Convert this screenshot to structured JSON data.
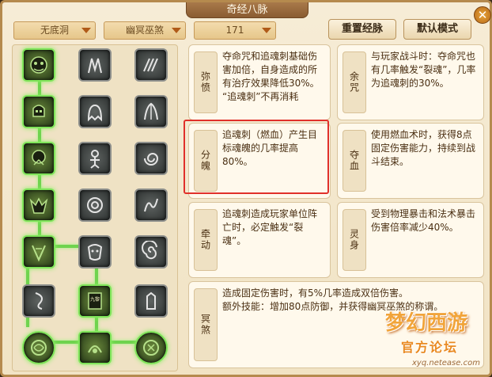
{
  "window": {
    "title": "奇经八脉",
    "close_label": "✕"
  },
  "toolbar": {
    "dropdown_1": "无底洞",
    "dropdown_2": "幽冥巫煞",
    "dropdown_3": "171",
    "reset_label": "重置经脉",
    "default_label": "默认模式"
  },
  "skill_tree": {
    "rows": [
      {
        "row": 1,
        "states": [
          "active",
          "inactive",
          "inactive"
        ]
      },
      {
        "row": 2,
        "states": [
          "active",
          "inactive",
          "inactive"
        ]
      },
      {
        "row": 3,
        "states": [
          "active",
          "inactive",
          "inactive"
        ]
      },
      {
        "row": 4,
        "states": [
          "active",
          "inactive",
          "inactive"
        ]
      },
      {
        "row": 5,
        "states": [
          "active",
          "inactive",
          "inactive"
        ]
      },
      {
        "row": 6,
        "states": [
          "inactive",
          "active",
          "inactive"
        ]
      },
      {
        "row": 7,
        "states": [
          "active",
          "active",
          "active"
        ]
      }
    ],
    "tome_label": "九黎"
  },
  "descriptions": [
    {
      "name": "弥愤",
      "text": "夺命咒和追魂刺基础伤害加倍，自身造成的所有治疗效果降低30%。\n“追魂刺”不再消耗"
    },
    {
      "name": "余咒",
      "text": "与玩家战斗时：夺命咒也有几率触发“裂魂”，几率为追魂刺的30%。"
    },
    {
      "name": "分魄",
      "text": "追魂刺（燃血）产生目标魂魄的几率提高80%。"
    },
    {
      "name": "夺血",
      "text": "使用燃血术时，获得8点固定伤害能力，持续到战斗结束。"
    },
    {
      "name": "牵动",
      "text": "追魂刺造成玩家单位阵亡时，必定触发“裂魂”。"
    },
    {
      "name": "灵身",
      "text": "受到物理暴击和法术暴击伤害倍率减少40%。"
    },
    {
      "name": "冥煞",
      "text": "造成固定伤害时，有5%几率造成双倍伤害。\n额外技能：增加80点防御，并获得幽冥巫煞的称谓。"
    }
  ],
  "watermark": {
    "logo": "梦幻西游",
    "sub": "官方论坛",
    "url": "xyq.netease.com"
  },
  "colors": {
    "active_glow": "#7fe45a",
    "highlight": "#e0302a",
    "frame": "#b58a4e"
  }
}
